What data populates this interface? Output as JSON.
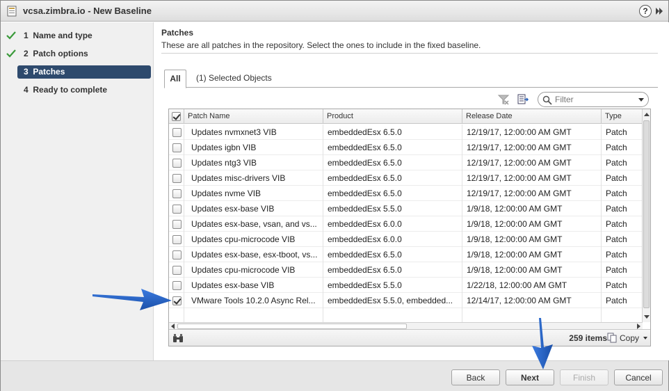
{
  "window": {
    "title": "vcsa.zimbra.io - New Baseline",
    "help": "?"
  },
  "steps": [
    {
      "number": "1",
      "label": "Name and type",
      "status": "done"
    },
    {
      "number": "2",
      "label": "Patch options",
      "status": "done"
    },
    {
      "number": "3",
      "label": "Patches",
      "status": "active"
    },
    {
      "number": "4",
      "label": "Ready to complete",
      "status": "pending"
    }
  ],
  "section": {
    "title": "Patches",
    "description": "These are all patches in the repository. Select the ones to include in the fixed baseline."
  },
  "tabs": {
    "all": "All",
    "selected": "(1) Selected Objects"
  },
  "filter": {
    "placeholder": "Filter"
  },
  "grid": {
    "columns": [
      "Patch Name",
      "Product",
      "Release Date",
      "Type"
    ],
    "rows": [
      {
        "checked": false,
        "name": "Updates nvmxnet3 VIB",
        "product": "embeddedEsx 6.5.0",
        "date": "12/19/17, 12:00:00 AM GMT",
        "type": "Patch"
      },
      {
        "checked": false,
        "name": "Updates igbn VIB",
        "product": "embeddedEsx 6.5.0",
        "date": "12/19/17, 12:00:00 AM GMT",
        "type": "Patch"
      },
      {
        "checked": false,
        "name": "Updates ntg3 VIB",
        "product": "embeddedEsx 6.5.0",
        "date": "12/19/17, 12:00:00 AM GMT",
        "type": "Patch"
      },
      {
        "checked": false,
        "name": "Updates misc-drivers VIB",
        "product": "embeddedEsx 6.5.0",
        "date": "12/19/17, 12:00:00 AM GMT",
        "type": "Patch"
      },
      {
        "checked": false,
        "name": "Updates nvme VIB",
        "product": "embeddedEsx 6.5.0",
        "date": "12/19/17, 12:00:00 AM GMT",
        "type": "Patch"
      },
      {
        "checked": false,
        "name": "Updates esx-base VIB",
        "product": "embeddedEsx 5.5.0",
        "date": "1/9/18, 12:00:00 AM GMT",
        "type": "Patch"
      },
      {
        "checked": false,
        "name": "Updates esx-base, vsan, and vs...",
        "product": "embeddedEsx 6.0.0",
        "date": "1/9/18, 12:00:00 AM GMT",
        "type": "Patch"
      },
      {
        "checked": false,
        "name": "Updates cpu-microcode VIB",
        "product": "embeddedEsx 6.0.0",
        "date": "1/9/18, 12:00:00 AM GMT",
        "type": "Patch"
      },
      {
        "checked": false,
        "name": "Updates esx-base, esx-tboot, vs...",
        "product": "embeddedEsx 6.5.0",
        "date": "1/9/18, 12:00:00 AM GMT",
        "type": "Patch"
      },
      {
        "checked": false,
        "name": "Updates cpu-microcode VIB",
        "product": "embeddedEsx 6.5.0",
        "date": "1/9/18, 12:00:00 AM GMT",
        "type": "Patch"
      },
      {
        "checked": false,
        "name": "Updates esx-base VIB",
        "product": "embeddedEsx 5.5.0",
        "date": "1/22/18, 12:00:00 AM GMT",
        "type": "Patch"
      },
      {
        "checked": true,
        "name": "VMware Tools 10.2.0 Async Rel...",
        "product": "embeddedEsx 5.5.0, embedded...",
        "date": "12/14/17, 12:00:00 AM GMT",
        "type": "Patch"
      }
    ],
    "item_count": "259 items",
    "copy_label": "Copy"
  },
  "buttons": {
    "back": "Back",
    "next": "Next",
    "finish": "Finish",
    "cancel": "Cancel"
  },
  "colors": {
    "active_step": "#2e4a6d",
    "check_green": "#3a9a3a",
    "arrow_blue": "#1f5fbf"
  }
}
